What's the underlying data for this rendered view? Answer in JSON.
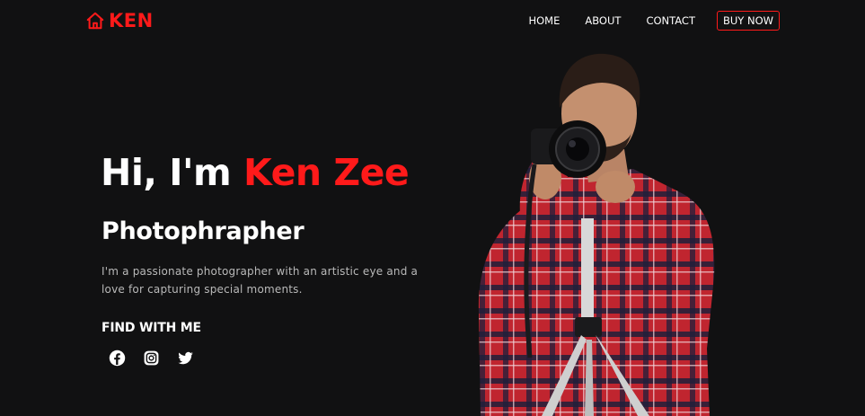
{
  "header": {
    "logo_icon": "home-icon",
    "logo_text": "KEN",
    "nav": [
      {
        "label": "HOME"
      },
      {
        "label": "ABOUT"
      },
      {
        "label": "CONTACT"
      },
      {
        "label": "BUY NOW"
      }
    ]
  },
  "hero": {
    "greeting": "Hi, I'm ",
    "name": "Ken Zee",
    "role": "Photophrapher",
    "description": "I'm a passionate photographer with an artistic eye and a love for capturing special moments.",
    "find_heading": "FIND WITH ME",
    "socials": [
      {
        "icon": "facebook-icon"
      },
      {
        "icon": "instagram-icon"
      },
      {
        "icon": "twitter-icon"
      }
    ]
  },
  "colors": {
    "background": "#111112",
    "accent": "#ff1a1a",
    "text": "#ffffff",
    "muted": "#b9b9b9"
  }
}
